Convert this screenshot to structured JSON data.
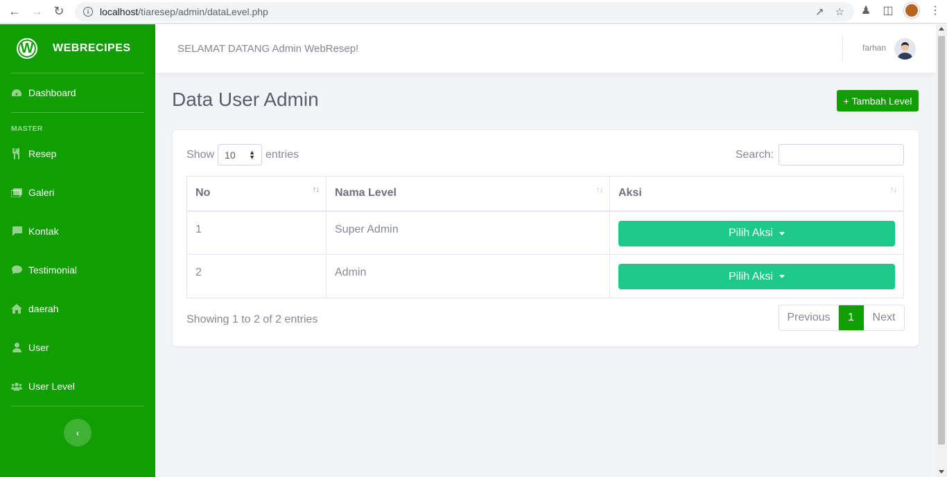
{
  "browser": {
    "url_host": "localhost",
    "url_path": "/tiaresep/admin/dataLevel.php"
  },
  "sidebar": {
    "brand_letter": "W",
    "brand_name": "WEBRECIPES",
    "dashboard_label": "Dashboard",
    "section_master": "MASTER",
    "items": [
      {
        "label": "Resep",
        "icon": "utensils-icon"
      },
      {
        "label": "Galeri",
        "icon": "images-icon"
      },
      {
        "label": "Kontak",
        "icon": "comment-square-icon"
      },
      {
        "label": "Testimonial",
        "icon": "comment-icon"
      },
      {
        "label": "daerah",
        "icon": "home-icon"
      },
      {
        "label": "User",
        "icon": "user-icon"
      },
      {
        "label": "User Level",
        "icon": "users-icon"
      }
    ]
  },
  "topbar": {
    "welcome": "SELAMAT DATANG Admin WebResep!",
    "username": "farhan"
  },
  "main": {
    "title": "Data User Admin",
    "add_button": "+ Tambah Level"
  },
  "table_controls": {
    "show_label": "Show",
    "entries_value": "10",
    "entries_label": "entries",
    "search_label": "Search:"
  },
  "table": {
    "headers": [
      "No",
      "Nama Level",
      "Aksi"
    ],
    "rows": [
      {
        "no": "1",
        "nama_level": "Super Admin",
        "aksi": "Pilih Aksi"
      },
      {
        "no": "2",
        "nama_level": "Admin",
        "aksi": "Pilih Aksi"
      }
    ]
  },
  "footer": {
    "info": "Showing 1 to 2 of 2 entries",
    "previous": "Previous",
    "current_page": "1",
    "next": "Next"
  },
  "colors": {
    "sidebar": "#109e03",
    "action_button": "#1cc88a"
  }
}
